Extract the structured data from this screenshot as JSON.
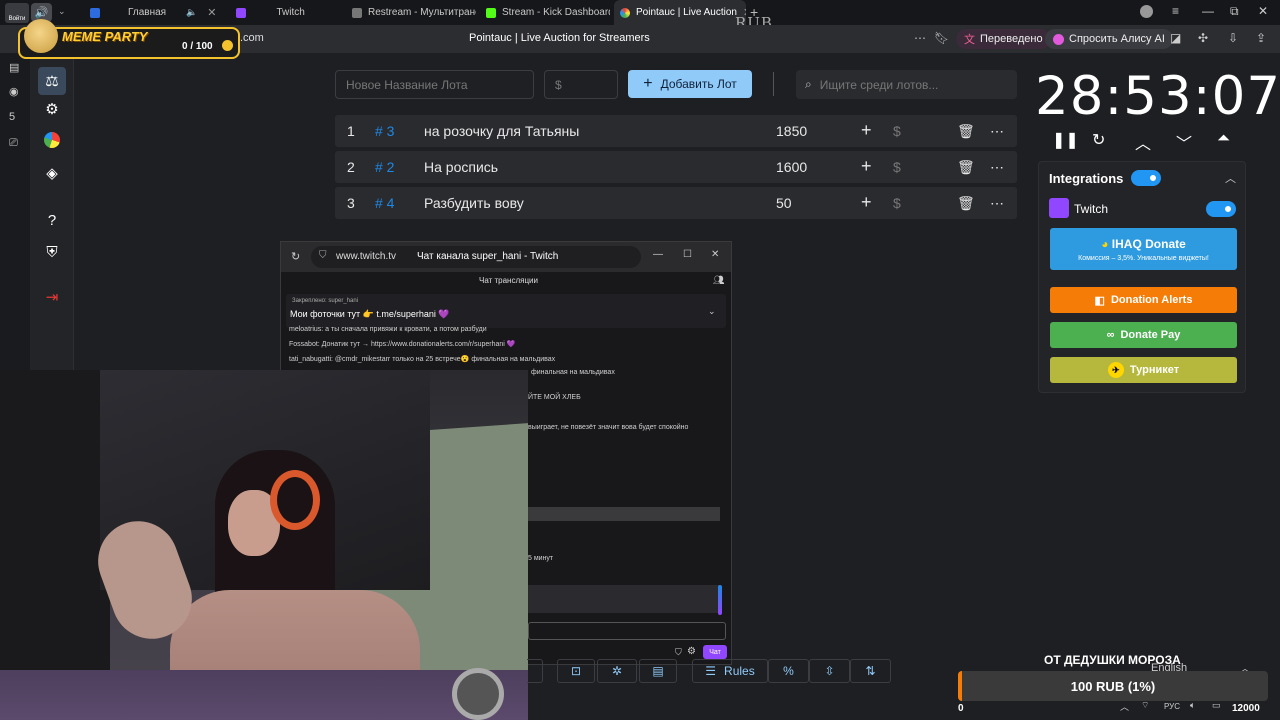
{
  "browser": {
    "tabs": [
      {
        "label": "Главная"
      },
      {
        "label": "Twitch"
      },
      {
        "label": "Restream - Мультитрансля"
      },
      {
        "label": "Stream - Kick Dashboard"
      },
      {
        "label": "Pointauc | Live Auction",
        "active": true
      }
    ],
    "corner_label": "Войти",
    "address_domain": ".com",
    "page_title": "Pointauc | Live Auction for Streamers",
    "translated_label": "Переведено",
    "alice_label": "Спросить Алису AI",
    "rub_watermark": "RUB"
  },
  "meme_party": {
    "title": "MEME PARTY",
    "counter": "0 / 100"
  },
  "auction": {
    "lot_name_placeholder": "Новое Название Лота",
    "amount_placeholder": "$",
    "add_button_label": "Добавить Лот",
    "search_placeholder": "Ищите среди лотов...",
    "lots": [
      {
        "index": "1",
        "tag": "# 3",
        "name": "на розочку для Татьяны",
        "amount": "1850"
      },
      {
        "index": "2",
        "tag": "# 2",
        "name": "На роспись",
        "amount": "1600"
      },
      {
        "index": "3",
        "tag": "# 4",
        "name": "Разбудить вову",
        "amount": "50"
      }
    ],
    "timer": "28:53:07"
  },
  "integrations": {
    "title": "Integrations",
    "twitch_label": "Twitch",
    "ihaq_label": "IHAQ Donate",
    "ihaq_subtitle": "Комиссия – 3,5%. Уникальные виджеты!",
    "donation_alerts_label": "Donation Alerts",
    "donate_pay_label": "Donate Pay",
    "turniket_label": "Турникет",
    "colors": {
      "toggle": "#2196f3",
      "ihaq": "#2e9be0",
      "donation_alerts": "#f57d07",
      "donate_pay": "#4caf50",
      "turniket": "#b5b83c"
    }
  },
  "twitch_popup": {
    "url": "www.twitch.tv",
    "title": "Чат канала super_hani - Twitch",
    "header": "Чат трансляции",
    "pinned_by": "Закреплено: super_hani",
    "pinned_text": "Мои фоточки тут 👉 t.me/superhani 💜",
    "chat_lines": [
      "meloatrius: а ты сначала привяжи к кровати, а потом разбуди",
      "Fossabot: Донатик тут → https://www.donationalerts.com/r/superhani 💜",
      "tati_nabugatti: @cmdr_mikestarr только на 25 встрече😮 финальная на мальдивах",
      "финальная на мальдивах",
      "ЙТЕ МОЙ ХЛЕБ",
      "выиграет, не повезёт значит вова будет спокойно",
      "5 минут"
    ],
    "chat_button": "Чат"
  },
  "toolbar": {
    "rules_label": "Rules",
    "percent_label": "%"
  },
  "overlay": {
    "from_label": "ОТ ДЕДУШКИ МОРОЗА",
    "language_label": "English",
    "donation_text": "100 RUB (1%)",
    "progress_start": "0",
    "progress_goal": "12000",
    "progress_fraction": 0.01,
    "keyboard_lang": "РУС"
  }
}
